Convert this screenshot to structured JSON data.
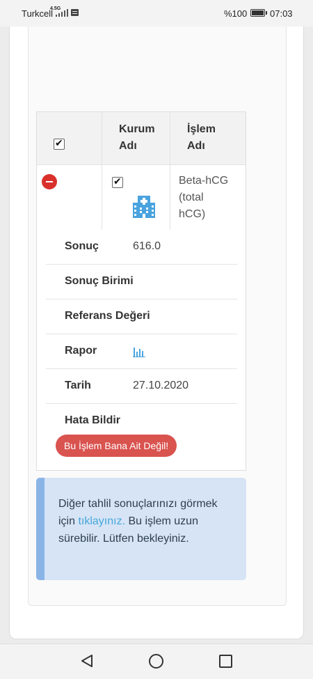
{
  "status_bar": {
    "carrier": "Turkcell",
    "network": "4.5G",
    "battery": "%100",
    "time": "07:03"
  },
  "table": {
    "headers": {
      "institution": [
        "Kurum",
        "Adı"
      ],
      "procedure": [
        "İşlem",
        "Adı"
      ]
    },
    "row": {
      "procedure_name": [
        "Beta-hCG",
        "(total",
        "hCG)"
      ],
      "institution_icon": "hospital-icon",
      "selected": true
    }
  },
  "details": [
    {
      "label": "Sonuç",
      "value": "616.0"
    },
    {
      "label": "Sonuç Birimi",
      "value": ""
    },
    {
      "label": "Referans Değeri",
      "value": ""
    },
    {
      "label": "Rapor",
      "value": "",
      "icon": "bar-chart-icon"
    },
    {
      "label": "Tarih",
      "value": "27.10.2020"
    }
  ],
  "report_error": {
    "label": "Hata Bildir",
    "button": "Bu İşlem Bana Ait Değil!"
  },
  "alert": {
    "text_before": "Diğer tahlil sonuçlarınızı görmek için ",
    "link": "tıklayınız.",
    "text_after": " Bu işlem uzun sürebilir. Lütfen bekleyiniz."
  },
  "colors": {
    "danger": "#d9534f",
    "alert_bg": "#d7e4f5",
    "alert_border": "#8ab4e6",
    "link": "#45a7db",
    "icon_blue": "#4aa3df"
  }
}
